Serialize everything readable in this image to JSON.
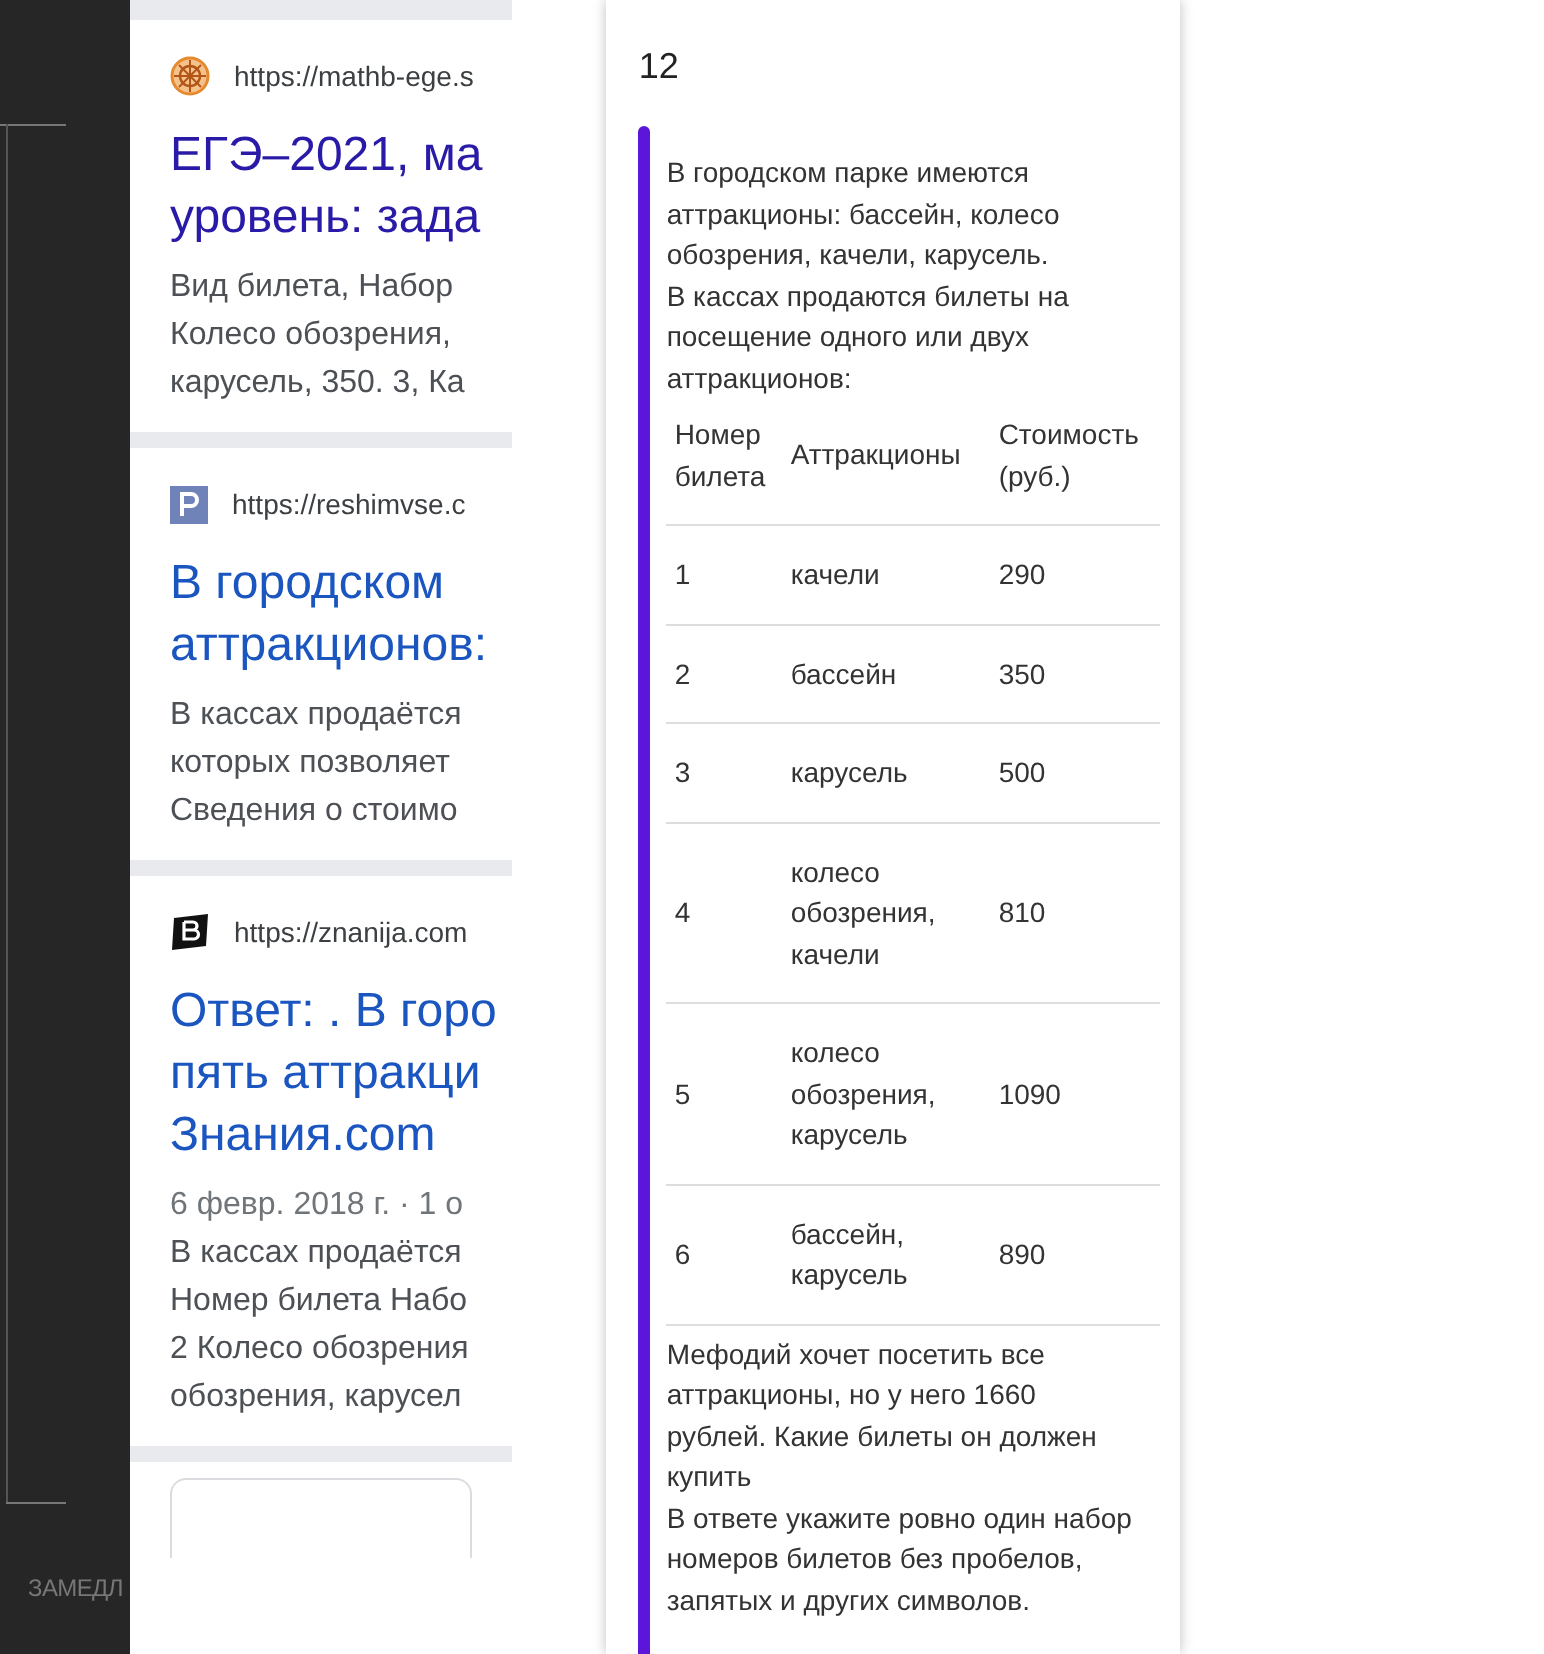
{
  "side_panel": {
    "label": "ЗАМЕДЛ"
  },
  "search_results": [
    {
      "kind": "wheel",
      "url": "https://mathb-ege.s",
      "title_lines": [
        "ЕГЭ–2021, ма",
        "уровень: зада"
      ],
      "snippet_lines": [
        "Вид билета, Набор",
        "Колесо обозрения,",
        "карусель, 350. 3, Ка"
      ]
    },
    {
      "kind": "letter_p",
      "url": "https://reshimvse.c",
      "title_lines": [
        "В городском",
        "аттракционов:"
      ],
      "snippet_lines": [
        "В кассах продаётся",
        "которых позволяет",
        "Сведения о стоимо"
      ]
    },
    {
      "kind": "letter_b",
      "url": "https://znanija.com",
      "title_lines": [
        "Ответ: . В горо",
        "пять аттракци",
        "Знания.com"
      ],
      "meta": "6 февр. 2018 г. · 1 о",
      "snippet_lines": [
        "В кассах продаётся",
        "Номер билета Набо",
        "2 Колесо обозрения",
        "обозрения, карусел"
      ]
    }
  ],
  "task": {
    "number": "12",
    "intro": "В городском парке имеются аттракционы: бассейн, колесо обозрения, качели, карусель.\nВ кассах продаются билеты на посещение одного или двух аттракционов:",
    "table": {
      "columns": [
        "Номер билета",
        "Аттракционы",
        "Стоимость (руб.)"
      ],
      "rows": [
        [
          "1",
          "качели",
          "290"
        ],
        [
          "2",
          "бассейн",
          "350"
        ],
        [
          "3",
          "карусель",
          "500"
        ],
        [
          "4",
          "колесо обозрения, качели",
          "810"
        ],
        [
          "5",
          "колесо обозрения, карусель",
          "1090"
        ],
        [
          "6",
          "бассейн, карусель",
          "890"
        ]
      ]
    },
    "question": "Мефодий хочет посетить все аттракционы, но у него 1660 рублей. Какие билеты он должен купить\nВ ответе укажите ровно один набор номеров билетов без пробелов, запятых и других символов."
  }
}
